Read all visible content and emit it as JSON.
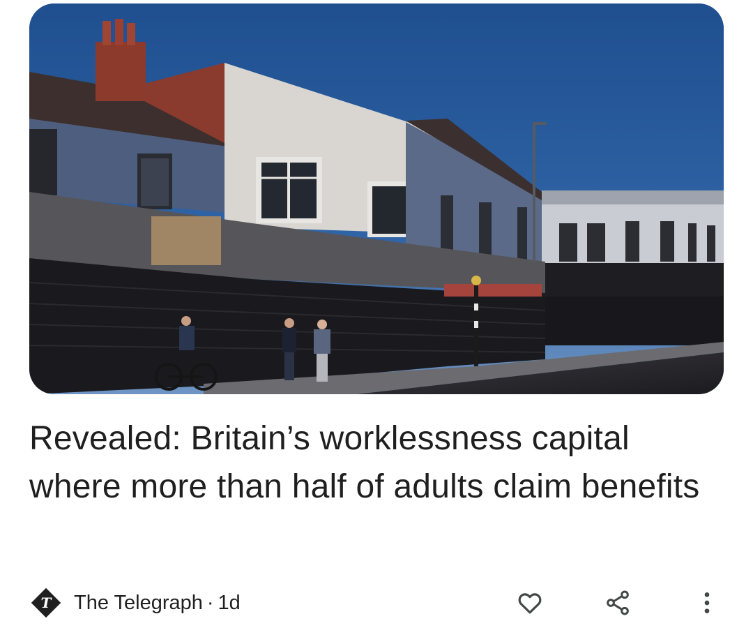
{
  "article": {
    "headline": "Revealed: Britain’s worklessness capital where more than half of adults claim benefits",
    "source": "The Telegraph",
    "separator": "·",
    "age": "1d",
    "image_icon": "article-photo"
  },
  "actions": {
    "like_icon": "heart-outline-icon",
    "share_icon": "share-icon",
    "more_icon": "more-vert-icon"
  },
  "colors": {
    "text": "#1f1f1f",
    "icon": "#444746"
  }
}
